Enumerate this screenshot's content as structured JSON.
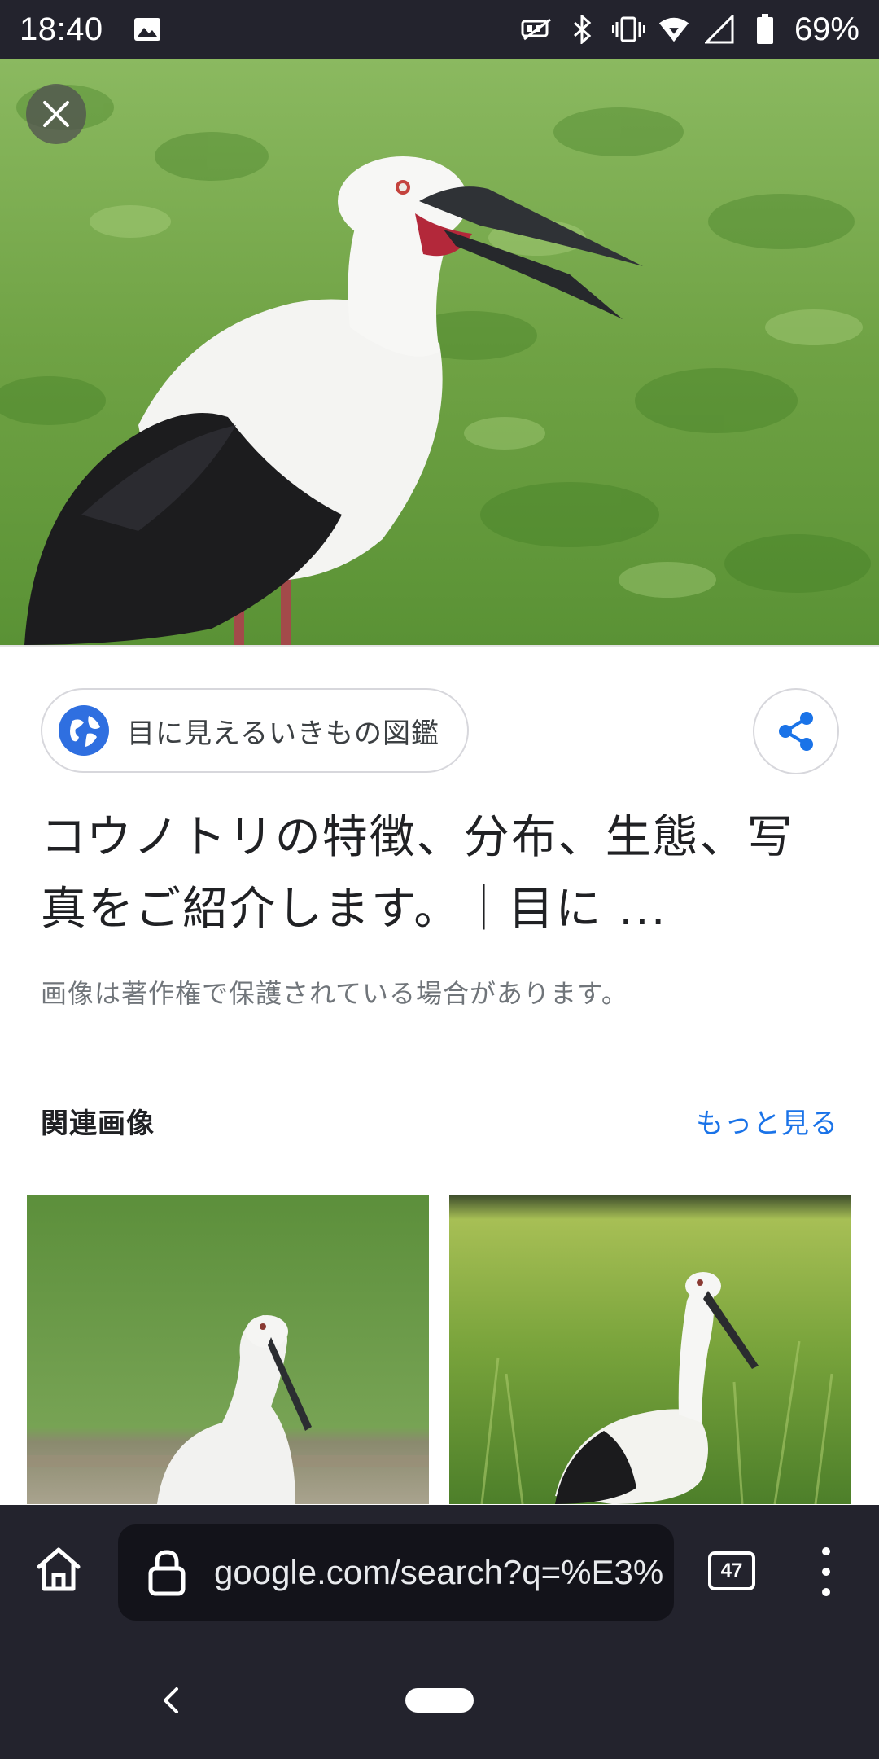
{
  "status_bar": {
    "time": "18:40",
    "battery_percent": "69%",
    "icons": [
      "image-icon",
      "no-sim-icon",
      "bluetooth-icon",
      "vibrate-icon",
      "wifi-icon",
      "signal-icon",
      "battery-icon"
    ]
  },
  "image_viewer": {
    "close_icon": "close-icon",
    "hero_description_icon": "stork-photo",
    "source": {
      "icon": "globe-icon",
      "name": "目に見えるいきもの図鑑"
    },
    "share_icon": "share-icon",
    "title_line1": "コウノトリの特徴、分布、生態、写",
    "title_line2": "真をご紹介します。｜目に ...",
    "copyright_notice": "画像は著作権で保護されている場合があります。",
    "related": {
      "heading": "関連画像",
      "more_link": "もっと見る"
    }
  },
  "browser_bar": {
    "home_icon": "home-icon",
    "lock_icon": "lock-icon",
    "url": "google.com/search?q=%E3%",
    "tab_count": "47",
    "menu_icon": "more-vert-icon"
  },
  "nav_bar": {
    "back_icon": "back-icon",
    "home_pill": "home-pill"
  },
  "colors": {
    "system_bar": "#23232d",
    "link_blue": "#1a73e8",
    "text_primary": "#202124",
    "text_secondary": "#70757a"
  }
}
